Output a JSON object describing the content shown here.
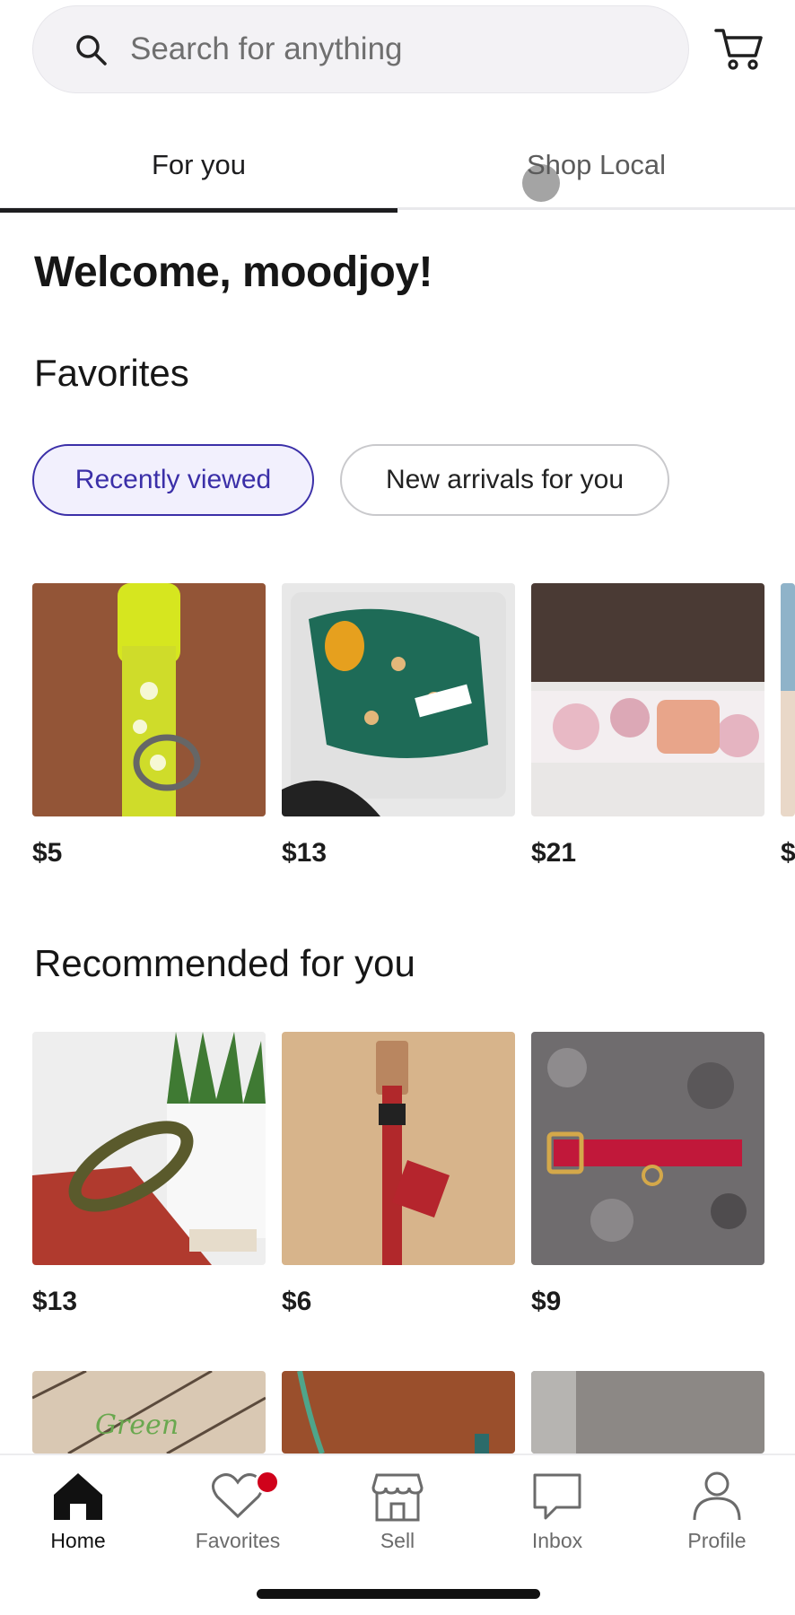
{
  "search": {
    "placeholder": "Search for anything"
  },
  "tabs": [
    {
      "label": "For you"
    },
    {
      "label": "Shop Local"
    }
  ],
  "welcome": "Welcome, moodjoy!",
  "favorites": {
    "title": "Favorites",
    "chips": [
      {
        "label": "Recently viewed",
        "selected": true
      },
      {
        "label": "New arrivals for you",
        "selected": false
      }
    ],
    "items": [
      {
        "price": "$5"
      },
      {
        "price": "$13"
      },
      {
        "price": "$21"
      },
      {
        "price": "$"
      }
    ]
  },
  "recommended": {
    "title": "Recommended for you",
    "items": [
      {
        "price": "$13"
      },
      {
        "price": "$6"
      },
      {
        "price": "$9"
      }
    ],
    "partial_text": "Green"
  },
  "nav": [
    {
      "label": "Home",
      "icon": "home-icon",
      "active": true
    },
    {
      "label": "Favorites",
      "icon": "heart-icon",
      "active": false
    },
    {
      "label": "Sell",
      "icon": "shop-icon",
      "active": false
    },
    {
      "label": "Inbox",
      "icon": "chat-icon",
      "active": false
    },
    {
      "label": "Profile",
      "icon": "person-icon",
      "active": false
    }
  ],
  "colors": {
    "accent": "#3b2fa8",
    "badge": "#d0021b"
  }
}
